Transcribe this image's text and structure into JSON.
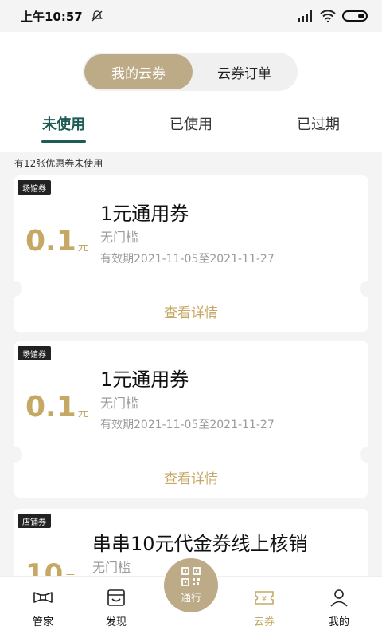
{
  "status": {
    "time": "上午10:57"
  },
  "segments": {
    "left": "我的云券",
    "right": "云券订单"
  },
  "tabs": {
    "unused": "未使用",
    "used": "已使用",
    "expired": "已过期"
  },
  "coupon_count_text": "有12张优惠券未使用",
  "coupons": [
    {
      "tag": "场馆券",
      "amount": "0.1",
      "unit": "元",
      "title": "1元通用券",
      "threshold": "无门槛",
      "validity": "有效期2021-11-05至2021-11-27",
      "details": "查看详情"
    },
    {
      "tag": "场馆券",
      "amount": "0.1",
      "unit": "元",
      "title": "1元通用券",
      "threshold": "无门槛",
      "validity": "有效期2021-11-05至2021-11-27",
      "details": "查看详情"
    },
    {
      "tag": "店铺券",
      "amount": "10",
      "unit": "元",
      "title": "串串10元代金券线上核销",
      "threshold": "无门槛"
    }
  ],
  "bottom_nav": {
    "butler": "管家",
    "discover": "发现",
    "center": "通行",
    "coupons": "云券",
    "mine": "我的"
  },
  "colors": {
    "accent_gold": "#c6a865",
    "segment_active": "#bdab88",
    "tab_active": "#1e5c55"
  }
}
